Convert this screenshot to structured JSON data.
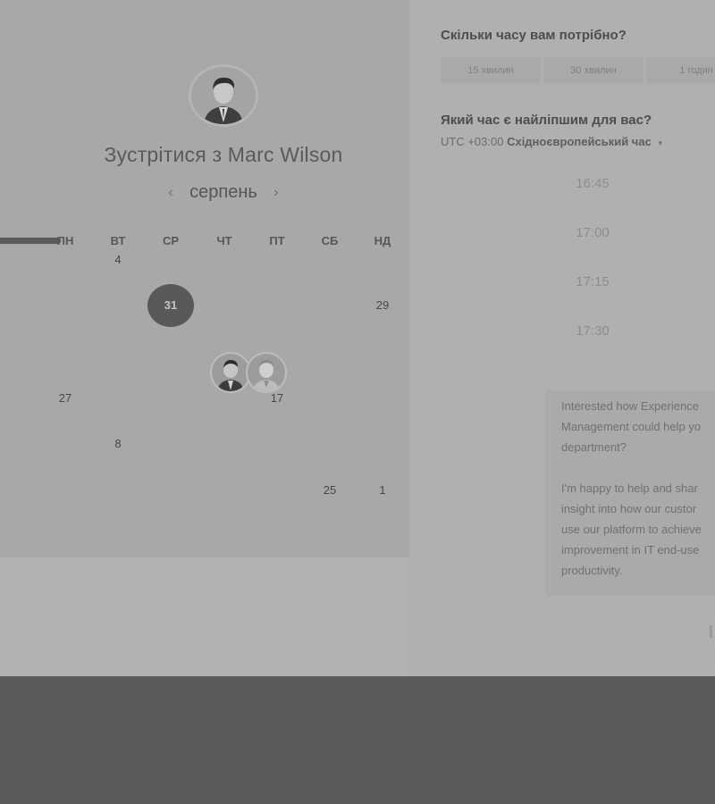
{
  "scheduler": {
    "title": "Зустрітися з Marc Wilson",
    "month": "серпень",
    "prev_month_icon": "‹",
    "next_month_icon": "›",
    "weekdays": [
      "ПН",
      "ВТ",
      "СР",
      "ЧТ",
      "ПТ",
      "СБ",
      "НД"
    ],
    "weeks": [
      [
        "",
        "4",
        "",
        "",
        "",
        "",
        ""
      ],
      [
        "",
        "",
        "31",
        "",
        "",
        "",
        "29"
      ],
      [
        "",
        "",
        "",
        "",
        "",
        "",
        ""
      ],
      [
        "27",
        "",
        "",
        "",
        "17",
        "",
        ""
      ],
      [
        "",
        "8",
        "",
        "",
        "",
        "",
        ""
      ],
      [
        "",
        "",
        "",
        "",
        "",
        "25",
        "1"
      ]
    ],
    "selected_day": "31"
  },
  "booking": {
    "duration_heading": "Скільки часу вам потрібно?",
    "durations": [
      "15 хвилин",
      "30 хвилин",
      "1 годин"
    ],
    "time_heading": "Який час є найліпшим для вас?",
    "timezone_prefix": "UTC +03:00",
    "timezone_name": "Східноєвропейський час",
    "timezone_caret": "▾",
    "time_slots": [
      "16:45",
      "17:00",
      "17:15",
      "17:30"
    ]
  },
  "host": {
    "lines": [
      "Interested how Experience",
      "Management could help yo",
      "department?",
      "",
      "I'm happy to help and shar",
      "insight into how our custor",
      "use our platform to achieve",
      "improvement in IT end-use",
      "productivity."
    ]
  }
}
